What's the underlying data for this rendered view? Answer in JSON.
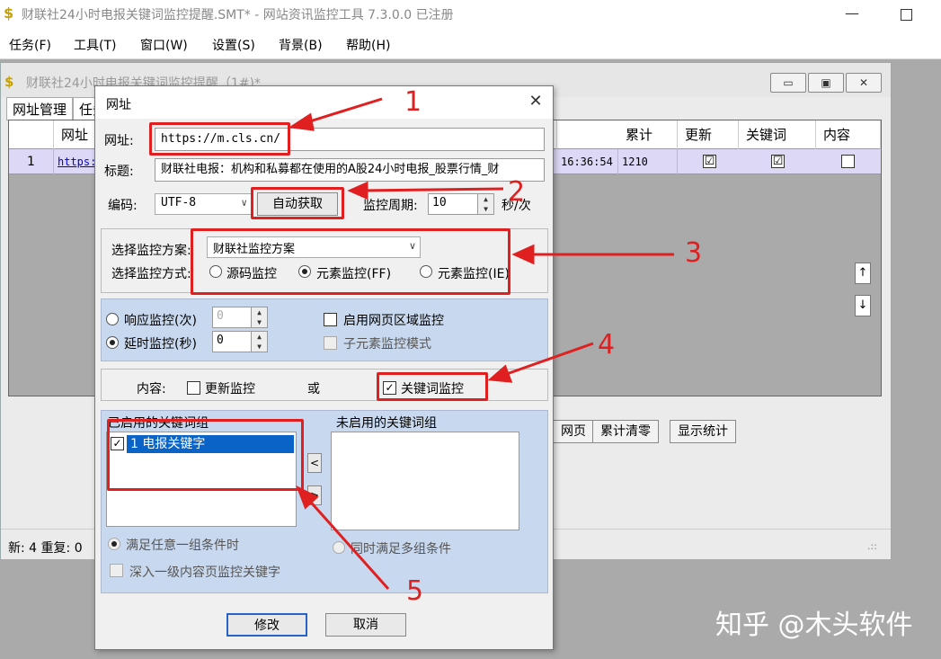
{
  "window": {
    "icon": "$",
    "title": "财联社24小时电报关键词监控提醒.SMT* - 网站资讯监控工具 7.3.0.0  已注册",
    "minimize": "—"
  },
  "menu": [
    "任务(F)",
    "工具(T)",
    "窗口(W)",
    "设置(S)",
    "背景(B)",
    "帮助(H)"
  ],
  "mdi": {
    "title": "财联社24小时电报关键词监控提醒（1#)*",
    "buttons": [
      "▭",
      "▣",
      "✕"
    ],
    "tabs": [
      "网址管理",
      "任务"
    ],
    "columns": [
      "",
      "网址",
      "累计",
      "更新",
      "关键词",
      "内容"
    ],
    "row": {
      "index": "1",
      "url": "https://",
      "time": "16:36:54",
      "total": "1210",
      "update": "☑",
      "keyword": "☑",
      "content": "☐"
    },
    "scroll_up": "↑",
    "scroll_down": "↓",
    "bottom_buttons": [
      "网页",
      "累计清零",
      "显示统计"
    ],
    "status": "新: 4  重复: 0",
    "grip": ".::"
  },
  "dialog": {
    "title": "网址",
    "close": "✕",
    "url_label": "网址:",
    "url_value": "https://m.cls.cn/",
    "title_label": "标题:",
    "title_value": "财联社电报：机构和私募都在使用的A股24小时电报_股票行情_财",
    "encoding_label": "编码:",
    "encoding_value": "UTF-8",
    "auto_button": "自动获取",
    "period_label": "监控周期:",
    "period_value": "10",
    "period_unit": "秒/次",
    "scheme_label": "选择监控方案:",
    "scheme_value": "财联社监控方案",
    "mode_label": "选择监控方式:",
    "modes": [
      "源码监控",
      "元素监控(FF)",
      "元素监控(IE)"
    ],
    "response_label": "响应监控(次)",
    "response_value": "0",
    "delay_label": "延时监控(秒)",
    "delay_value": "0",
    "region_label": "启用网页区域监控",
    "child_label": "子元素监控模式",
    "content_label": "内容:",
    "update_monitor": "更新监控",
    "or": "或",
    "keyword_monitor": "关键词监控",
    "enabled_groups_label": "已启用的关键词组",
    "enabled_groups": [
      "1 电报关键字"
    ],
    "disabled_groups_label": "未启用的关键词组",
    "move_left": "<",
    "move_right": ">",
    "any_condition": "满足任意一组条件时",
    "all_condition": "同时满足多组条件",
    "deep_label": "深入一级内容页监控关键字",
    "ok": "修改",
    "cancel": "取消"
  },
  "annotations": [
    "1",
    "2",
    "3",
    "4",
    "5"
  ],
  "watermark": "知乎 @木头软件",
  "colors": {
    "annotation": "#e02020",
    "row_highlight": "#dcd8f5",
    "panel_blue": "#c8d8ee",
    "selection": "#0a64c8"
  }
}
